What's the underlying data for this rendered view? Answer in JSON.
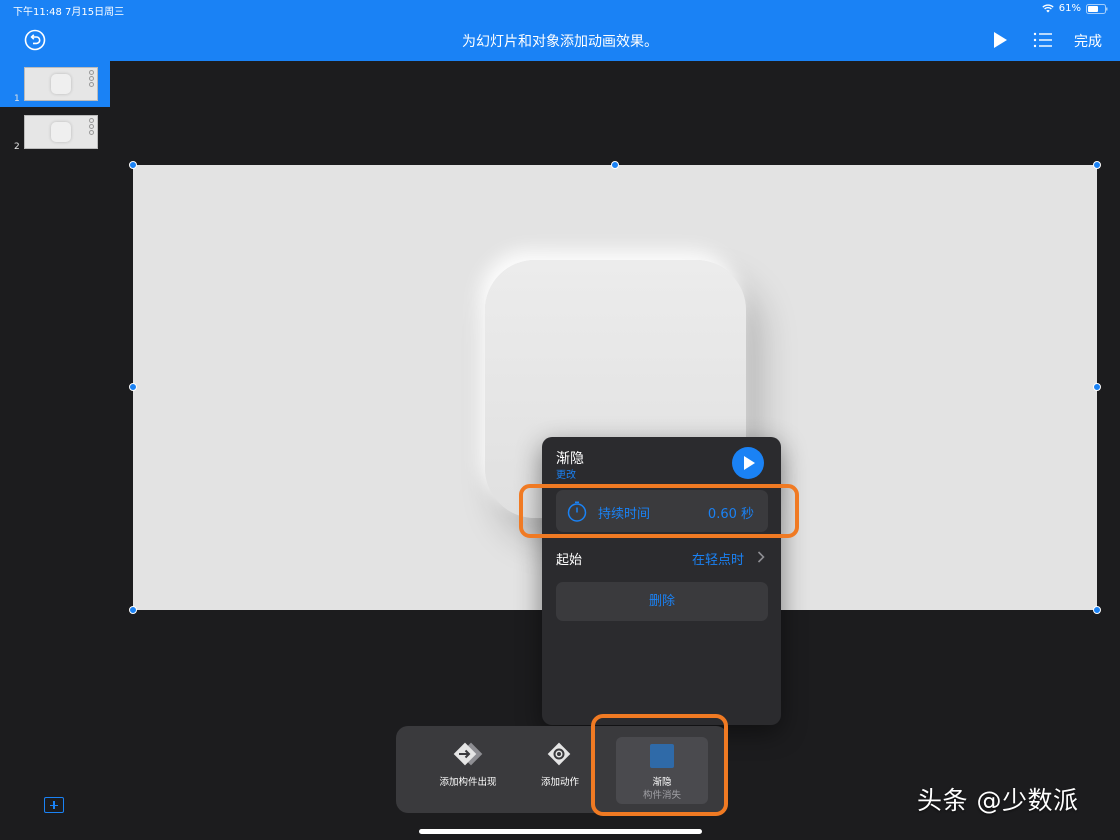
{
  "status": {
    "time_date": "下午11:48   7月15日周三",
    "battery": "61%"
  },
  "toolbar": {
    "title": "为幻灯片和对象添加动画效果。",
    "done_label": "完成"
  },
  "sidebar": {
    "slides": [
      {
        "number": "1",
        "active": true
      },
      {
        "number": "2",
        "active": false
      }
    ]
  },
  "popover": {
    "effect_name": "渐隐",
    "change_label": "更改",
    "duration_label": "持续时间",
    "duration_value": "0.60 秒",
    "start_label": "起始",
    "start_value": "在轻点时",
    "delete_label": "删除"
  },
  "bottom_bar": {
    "add_build_in_label": "添加构件出现",
    "add_action_label": "添加动作",
    "build_out_effect": "渐隐",
    "build_out_sub": "构件消失"
  },
  "watermark": "头条 @少数派",
  "colors": {
    "accent": "#1a82f5",
    "highlight": "#f07a23"
  }
}
